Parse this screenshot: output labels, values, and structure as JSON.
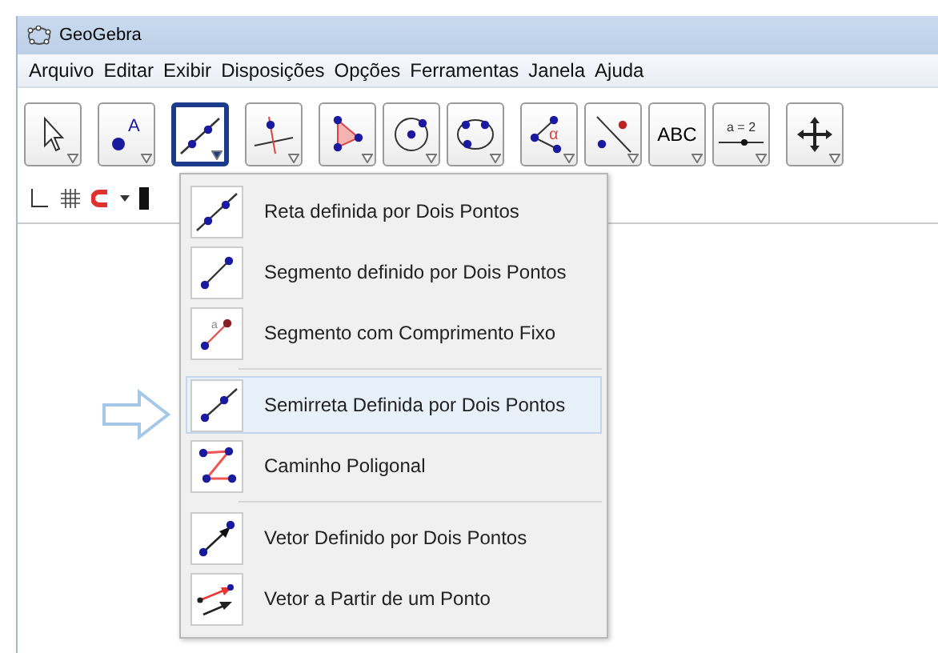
{
  "window": {
    "title": "GeoGebra"
  },
  "menu": [
    "Arquivo",
    "Editar",
    "Exibir",
    "Disposições",
    "Opções",
    "Ferramentas",
    "Janela",
    "Ajuda"
  ],
  "toolbar": [
    {
      "tools": [
        {
          "kind": "move",
          "selected": false
        }
      ]
    },
    {
      "tools": [
        {
          "kind": "point",
          "selected": false,
          "label": "A"
        }
      ]
    },
    {
      "tools": [
        {
          "kind": "line",
          "selected": true
        }
      ]
    },
    {
      "tools": [
        {
          "kind": "perpendicular",
          "selected": false
        }
      ]
    },
    {
      "tools": [
        {
          "kind": "polygon",
          "selected": false
        },
        {
          "kind": "circle",
          "selected": false
        },
        {
          "kind": "conic",
          "selected": false
        }
      ]
    },
    {
      "tools": [
        {
          "kind": "angle",
          "selected": false,
          "label": "α"
        },
        {
          "kind": "reflect",
          "selected": false
        },
        {
          "kind": "text",
          "selected": false,
          "label": "ABC"
        },
        {
          "kind": "slider",
          "selected": false,
          "label": "a = 2"
        }
      ]
    },
    {
      "tools": [
        {
          "kind": "pan",
          "selected": false
        }
      ]
    }
  ],
  "dropdown": {
    "sections": [
      {
        "items": [
          {
            "kind": "line",
            "label": "Reta definida por Dois Pontos",
            "selected": false
          },
          {
            "kind": "segment",
            "label": "Segmento definido por Dois Pontos",
            "selected": false
          },
          {
            "kind": "fixed_segment",
            "label": "Segmento com Comprimento Fixo",
            "selected": false,
            "icon_label": "a"
          }
        ]
      },
      {
        "items": [
          {
            "kind": "ray",
            "label": "Semirreta Definida por Dois Pontos",
            "selected": true
          },
          {
            "kind": "polyline",
            "label": "Caminho Poligonal",
            "selected": false
          }
        ]
      },
      {
        "items": [
          {
            "kind": "vector",
            "label": "Vetor Definido por Dois Pontos",
            "selected": false
          },
          {
            "kind": "vector_from_point",
            "label": "Vetor a Partir de um Ponto",
            "selected": false
          }
        ]
      }
    ]
  }
}
